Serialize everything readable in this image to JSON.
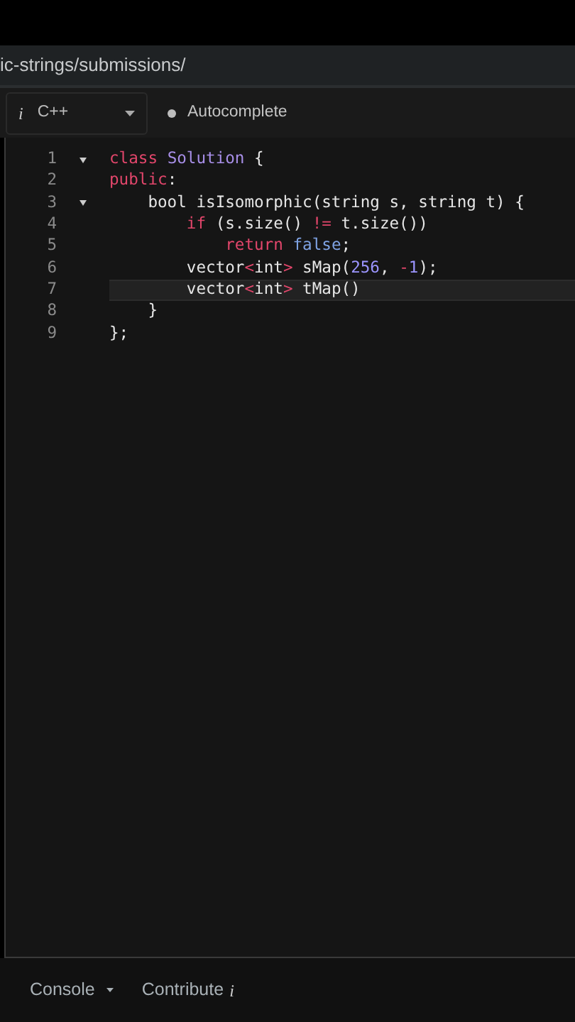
{
  "address_bar": {
    "url": "ic-strings/submissions/"
  },
  "toolbar": {
    "language": {
      "icon": "i",
      "label": "C++"
    },
    "autocomplete": {
      "label": "Autocomplete",
      "on": false
    }
  },
  "editor": {
    "lines": [
      {
        "number": "1",
        "foldable": true,
        "current": false,
        "tokens": [
          {
            "kind": "keyword",
            "text": "class"
          },
          {
            "kind": "class",
            "text": " Solution"
          },
          {
            "kind": "plain",
            "text": " {"
          }
        ]
      },
      {
        "number": "2",
        "foldable": false,
        "current": false,
        "tokens": [
          {
            "kind": "keyword",
            "text": "public"
          },
          {
            "kind": "plain",
            "text": ":"
          }
        ]
      },
      {
        "number": "3",
        "foldable": true,
        "current": false,
        "tokens": [
          {
            "kind": "plain",
            "text": "    bool isIsomorphic(string s, string t) {"
          }
        ]
      },
      {
        "number": "4",
        "foldable": false,
        "current": false,
        "tokens": [
          {
            "kind": "keyword",
            "text": "        if"
          },
          {
            "kind": "plain",
            "text": " (s.size() "
          },
          {
            "kind": "operator",
            "text": "!="
          },
          {
            "kind": "plain",
            "text": " t.size())"
          }
        ]
      },
      {
        "number": "5",
        "foldable": false,
        "current": false,
        "tokens": [
          {
            "kind": "keyword",
            "text": "            return"
          },
          {
            "kind": "constant",
            "text": " false"
          },
          {
            "kind": "plain",
            "text": ";"
          }
        ]
      },
      {
        "number": "6",
        "foldable": false,
        "current": false,
        "tokens": [
          {
            "kind": "plain",
            "text": "        vector"
          },
          {
            "kind": "operator",
            "text": "<"
          },
          {
            "kind": "plain",
            "text": "int"
          },
          {
            "kind": "operator",
            "text": ">"
          },
          {
            "kind": "plain",
            "text": " sMap("
          },
          {
            "kind": "number",
            "text": "256"
          },
          {
            "kind": "plain",
            "text": ", "
          },
          {
            "kind": "operator",
            "text": "-"
          },
          {
            "kind": "number",
            "text": "1"
          },
          {
            "kind": "plain",
            "text": ");"
          }
        ]
      },
      {
        "number": "7",
        "foldable": false,
        "current": true,
        "tokens": [
          {
            "kind": "plain",
            "text": "        vector"
          },
          {
            "kind": "operator",
            "text": "<"
          },
          {
            "kind": "plain",
            "text": "int"
          },
          {
            "kind": "operator",
            "text": ">"
          },
          {
            "kind": "plain",
            "text": " tMap()"
          }
        ]
      },
      {
        "number": "8",
        "foldable": false,
        "current": false,
        "tokens": [
          {
            "kind": "plain",
            "text": "    }"
          }
        ]
      },
      {
        "number": "9",
        "foldable": false,
        "current": false,
        "tokens": [
          {
            "kind": "plain",
            "text": "};"
          }
        ]
      }
    ]
  },
  "footer": {
    "console": "Console",
    "contribute": {
      "label": "Contribute",
      "icon": "i"
    }
  }
}
